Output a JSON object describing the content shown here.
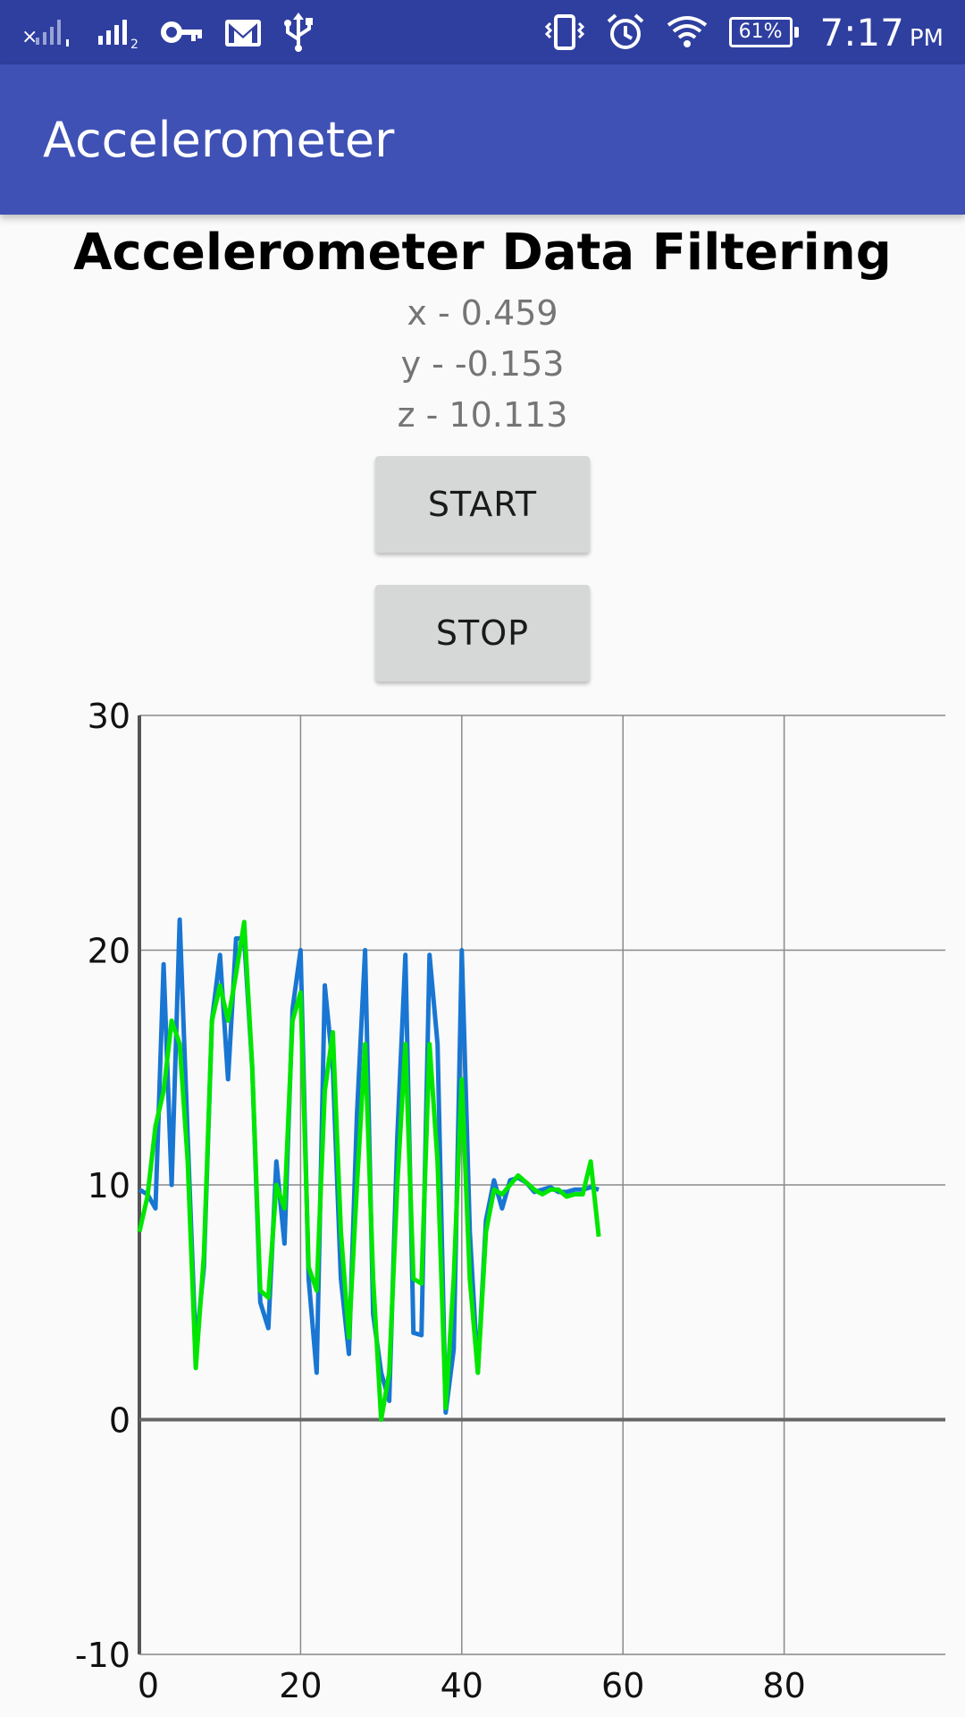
{
  "status_bar": {
    "icons": [
      "signal-sim1-icon",
      "signal-sim2-icon",
      "vpn-key-icon",
      "gmail-icon",
      "usb-icon",
      "vibrate-icon",
      "alarm-icon",
      "wifi-icon",
      "battery-icon"
    ],
    "battery": "61%",
    "time": "7:17",
    "ampm": "PM"
  },
  "app_bar": {
    "title": "Accelerometer",
    "color": "#3f51b5"
  },
  "main": {
    "heading": "Accelerometer Data Filtering",
    "x_readout": "x - 0.459",
    "y_readout": "y - -0.153",
    "z_readout": "z - 10.113",
    "start_label": "START",
    "stop_label": "STOP"
  },
  "chart_data": {
    "type": "line",
    "xlim": [
      0,
      100
    ],
    "ylim": [
      -10,
      30
    ],
    "x_ticks": [
      "0",
      "20",
      "40",
      "60",
      "80"
    ],
    "y_ticks": [
      "30",
      "20",
      "10",
      "0",
      "-10"
    ],
    "grid": true,
    "series": [
      {
        "color": "#1976d2",
        "x": [
          0,
          1,
          2,
          3,
          4,
          5,
          6,
          7,
          8,
          9,
          10,
          11,
          12,
          13,
          14,
          15,
          16,
          17,
          18,
          19,
          20,
          21,
          22,
          23,
          24,
          25,
          26,
          27,
          28,
          29,
          30,
          31,
          32,
          33,
          34,
          35,
          36,
          37,
          38,
          39,
          40,
          41,
          42,
          43,
          44,
          45,
          46,
          47,
          48,
          49,
          50,
          51,
          52,
          53,
          54,
          55,
          56,
          57
        ],
        "values": [
          9.8,
          9.6,
          9.0,
          19.4,
          10.0,
          21.3,
          12.0,
          3.0,
          6.5,
          17.0,
          19.8,
          14.5,
          20.5,
          20.5,
          15.0,
          5.0,
          3.9,
          11.0,
          7.5,
          17.5,
          20.0,
          6.0,
          2.0,
          18.5,
          15.0,
          6.0,
          2.8,
          13.0,
          20.0,
          4.5,
          2.0,
          0.8,
          12.0,
          19.8,
          3.7,
          3.6,
          19.8,
          16.0,
          0.3,
          3.0,
          20.0,
          8.0,
          2.0,
          8.5,
          10.2,
          9.0,
          10.2,
          10.3,
          10.1,
          9.7,
          9.8,
          9.9,
          9.7,
          9.7,
          9.8,
          9.8,
          9.9,
          9.8
        ]
      },
      {
        "color": "#00e600",
        "x": [
          0,
          1,
          2,
          3,
          4,
          5,
          6,
          7,
          8,
          9,
          10,
          11,
          12,
          13,
          14,
          15,
          16,
          17,
          18,
          19,
          20,
          21,
          22,
          23,
          24,
          25,
          26,
          27,
          28,
          29,
          30,
          31,
          32,
          33,
          34,
          35,
          36,
          37,
          38,
          39,
          40,
          41,
          42,
          43,
          44,
          45,
          46,
          47,
          48,
          49,
          50,
          51,
          52,
          53,
          54,
          55,
          56,
          57
        ],
        "values": [
          8.0,
          9.5,
          12.5,
          14.0,
          17.0,
          16.0,
          11.0,
          2.2,
          7.0,
          17.0,
          18.5,
          17.0,
          19.0,
          21.2,
          15.0,
          5.5,
          5.2,
          10.0,
          9.0,
          17.0,
          18.2,
          6.5,
          5.5,
          14.0,
          16.5,
          8.0,
          3.5,
          10.0,
          16.0,
          6.0,
          0.0,
          2.0,
          10.0,
          16.0,
          6.0,
          5.8,
          16.0,
          11.0,
          0.5,
          6.0,
          14.5,
          6.0,
          2.0,
          8.0,
          9.8,
          9.6,
          10.0,
          10.4,
          10.1,
          9.8,
          9.6,
          9.8,
          9.8,
          9.5,
          9.6,
          9.6,
          11.0,
          7.8
        ]
      }
    ]
  }
}
